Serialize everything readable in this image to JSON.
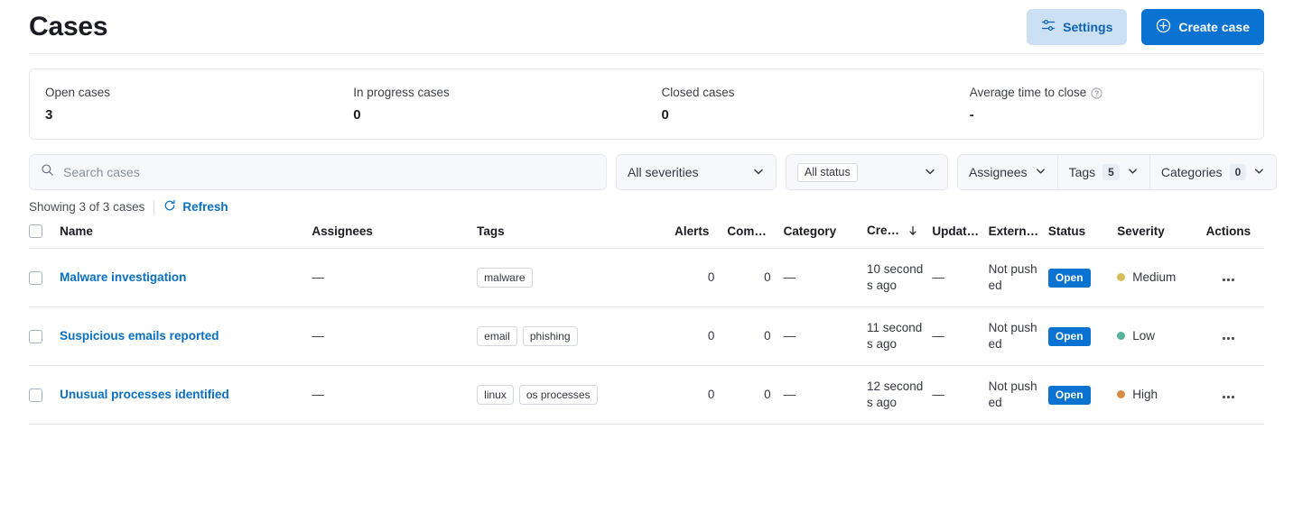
{
  "header": {
    "title": "Cases",
    "settings_label": "Settings",
    "create_label": "Create case",
    "settings_icon": "sliders-icon",
    "create_icon": "plus-circle-icon"
  },
  "stats": [
    {
      "label": "Open cases",
      "value": "3",
      "has_help": false
    },
    {
      "label": "In progress cases",
      "value": "0",
      "has_help": false
    },
    {
      "label": "Closed cases",
      "value": "0",
      "has_help": false
    },
    {
      "label": "Average time to close",
      "value": "-",
      "has_help": true
    }
  ],
  "filters": {
    "search_placeholder": "Search cases",
    "search_value": "",
    "search_icon": "search-icon",
    "severity_label": "All severities",
    "status_label": "All status",
    "assignees_label": "Assignees",
    "tags_label": "Tags",
    "tags_count": "5",
    "categories_label": "Categories",
    "categories_count": "0"
  },
  "toolbar": {
    "showing_text": "Showing 3 of 3 cases",
    "refresh_label": "Refresh",
    "refresh_icon": "refresh-icon"
  },
  "table": {
    "columns": [
      {
        "key": "name",
        "label": "Name"
      },
      {
        "key": "assignees",
        "label": "Assignees"
      },
      {
        "key": "tags",
        "label": "Tags"
      },
      {
        "key": "alerts",
        "label": "Alerts"
      },
      {
        "key": "comments",
        "label": "Comm…"
      },
      {
        "key": "category",
        "label": "Category"
      },
      {
        "key": "created",
        "label": "Cre…",
        "sorted": "desc"
      },
      {
        "key": "updated",
        "label": "Update…"
      },
      {
        "key": "external",
        "label": "Extern…"
      },
      {
        "key": "status",
        "label": "Status"
      },
      {
        "key": "severity",
        "label": "Severity"
      },
      {
        "key": "actions",
        "label": "Actions"
      }
    ],
    "rows": [
      {
        "name": "Malware investigation",
        "assignees": "—",
        "tags": [
          "malware"
        ],
        "alerts": "0",
        "comments": "0",
        "category": "—",
        "created": "10 seconds ago",
        "updated": "—",
        "external": "Not pushed",
        "status": "Open",
        "severity": "Medium",
        "severity_color": "#d6bf57"
      },
      {
        "name": "Suspicious emails reported",
        "assignees": "—",
        "tags": [
          "email",
          "phishing"
        ],
        "alerts": "0",
        "comments": "0",
        "category": "—",
        "created": "11 seconds ago",
        "updated": "—",
        "external": "Not pushed",
        "status": "Open",
        "severity": "Low",
        "severity_color": "#54b399"
      },
      {
        "name": "Unusual processes identified",
        "assignees": "—",
        "tags": [
          "linux",
          "os processes"
        ],
        "alerts": "0",
        "comments": "0",
        "category": "—",
        "created": "12 seconds ago",
        "updated": "—",
        "external": "Not pushed",
        "status": "Open",
        "severity": "High",
        "severity_color": "#da8b45"
      }
    ]
  },
  "colors": {
    "primary_blue": "#0a72d0",
    "link_blue": "#0a6fc2",
    "settings_bg": "#cce0f4",
    "border": "#e3e6ec",
    "field_bg": "#f7f8fc"
  }
}
